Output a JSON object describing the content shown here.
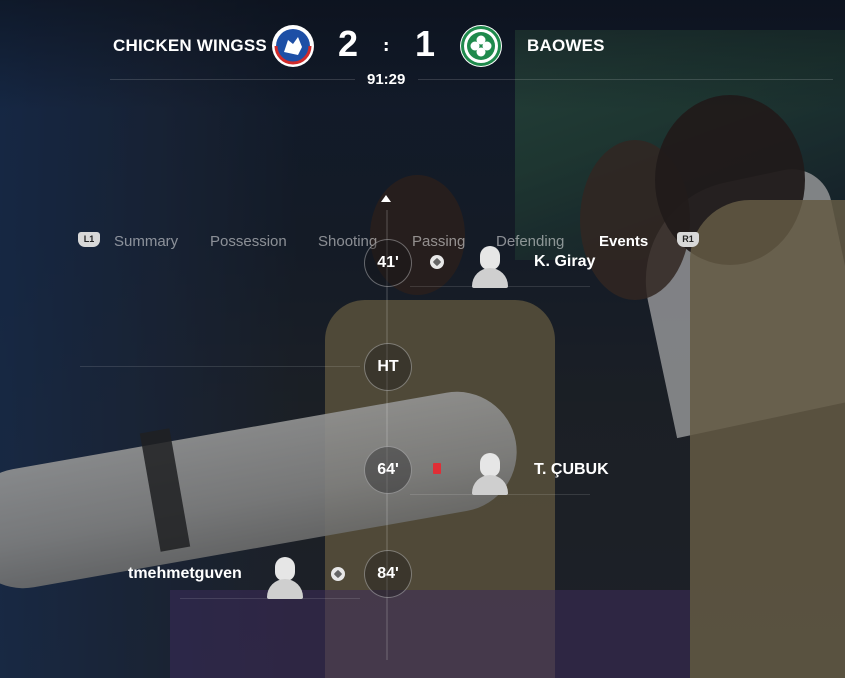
{
  "match": {
    "home_team": "CHICKEN WINGSS",
    "away_team": "BAOWES",
    "home_score": "2",
    "separator": ":",
    "away_score": "1",
    "clock": "91:29",
    "home_crest": "fc-copenhagen-lion-crest-icon",
    "away_crest": "celtic-clover-crest-icon"
  },
  "tabs": {
    "left_button": "L1",
    "right_button": "R1",
    "items": [
      {
        "label": "Summary",
        "active": false
      },
      {
        "label": "Possession",
        "active": false
      },
      {
        "label": "Shooting",
        "active": false
      },
      {
        "label": "Passing",
        "active": false
      },
      {
        "label": "Defending",
        "active": false
      },
      {
        "label": "Events",
        "active": true
      }
    ]
  },
  "events": [
    {
      "minute": "41'",
      "side": "away",
      "type": "goal",
      "icon": "football-icon",
      "player": "K. Giray"
    },
    {
      "minute": "HT",
      "side": "none",
      "type": "half-time",
      "icon": "",
      "player": ""
    },
    {
      "minute": "64'",
      "side": "away",
      "type": "red-card",
      "icon": "red-card-icon",
      "player": "T. ÇUBUK"
    },
    {
      "minute": "84'",
      "side": "home",
      "type": "goal",
      "icon": "football-icon",
      "player": "tmehmetguven"
    }
  ],
  "colors": {
    "text": "#ffffff",
    "inactive_tab": "#8a8d93",
    "red_card": "#e02e36",
    "home_crest_blue": "#1d4fa6",
    "away_crest_green": "#1f8a4c"
  }
}
